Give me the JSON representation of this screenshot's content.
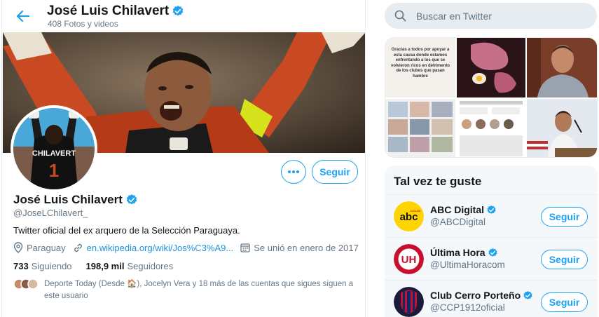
{
  "header": {
    "name": "José Luis Chilavert",
    "media_count": "408 Fotos y videos"
  },
  "profile": {
    "name": "José Luis Chilavert",
    "handle": "@JoseLChilavert_",
    "bio": "Twitter oficial del ex arquero de la Selección Paraguaya.",
    "location": "Paraguay",
    "website": "en.wikipedia.org/wiki/Jos%C3%A9...",
    "joined": "Se unió en enero de 2017",
    "following_count": "733",
    "following_label": "Siguiendo",
    "followers_count": "198,9 mil",
    "followers_label": "Seguidores",
    "follow_label": "Seguir",
    "known_followers": "Deporte Today (Desde 🏠), Jocelyn Vera y 18 más de las cuentas que sigues siguen a este usuario",
    "avatar_jersey_text": "CHILAVERT"
  },
  "search": {
    "placeholder": "Buscar en Twitter"
  },
  "media": {
    "tile_text": "Gracias a todos por apoyar a esta causa donde estamos enfrentando a los que se volvieron ricos en detrimento de los clubes que pasan hambre"
  },
  "suggestions": {
    "title": "Tal vez te guste",
    "items": [
      {
        "name": "ABC Digital",
        "handle": "@ABCDigital",
        "follow_label": "Seguir",
        "logo_text": "abc",
        "logo_sub": "COLOR"
      },
      {
        "name": "Última Hora",
        "handle": "@UltimaHoracom",
        "follow_label": "Seguir",
        "logo_text": "UH"
      },
      {
        "name": "Club Cerro Porteño",
        "handle": "@CCP1912oficial",
        "follow_label": "Seguir"
      }
    ]
  },
  "colors": {
    "accent": "#1da1f2",
    "text": "#14171a",
    "muted": "#657786"
  }
}
